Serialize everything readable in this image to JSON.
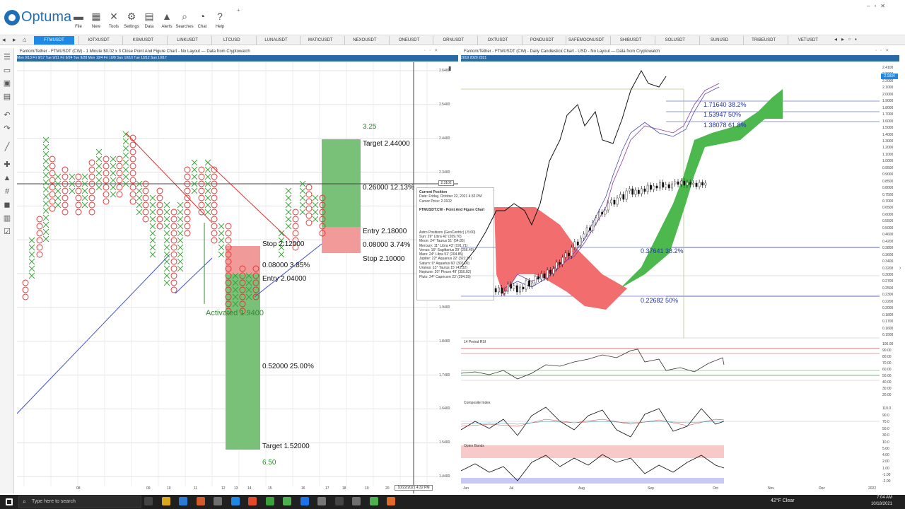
{
  "app": {
    "logo_text": "Optuma"
  },
  "ribbon": {
    "buttons": [
      {
        "label": "File",
        "icon": "folder-icon",
        "glyph": "▬"
      },
      {
        "label": "New",
        "icon": "new-chart-icon",
        "glyph": "▦"
      },
      {
        "label": "Tools",
        "icon": "tools-icon",
        "glyph": "✕"
      },
      {
        "label": "Settings",
        "icon": "gear-icon",
        "glyph": "⚙"
      },
      {
        "label": "Data",
        "icon": "data-icon",
        "glyph": "▤"
      },
      {
        "label": "Alerts",
        "icon": "alert-icon",
        "glyph": "▲"
      },
      {
        "label": "Searches",
        "icon": "search-icon",
        "glyph": "⌕"
      },
      {
        "label": "Chat",
        "icon": "chat-icon",
        "glyph": "◔"
      },
      {
        "label": "Help",
        "icon": "help-icon",
        "glyph": "?"
      }
    ]
  },
  "symbols": [
    "FTMUSDT",
    "IOTXUSDT",
    "KSMUSDT",
    "LINKUSDT",
    "LTCUSD",
    "LUNAUSDT",
    "MATICUSDT",
    "NEXOUSDT",
    "ONEUSDT",
    "ORNUSDT",
    "OXTUSDT",
    "PONDUSDT",
    "SAFEMOONUSDT",
    "SHIBUSDT",
    "SOLUSDT",
    "SUNUSD",
    "TRIBEUSDT",
    "VETUSDT"
  ],
  "left_chart": {
    "title": "Fantom/Tether - FTMUSDT (CW) - 1 Minute $0.02 x 3 Close Point And Figure Chart - No Layout — Data from Cryptowatch",
    "date_bar": "Mon 9/13   Fri 9/17   Tue 9/21   Fri 9/24   Tue 9/28   Mon 10/4        Fri 10/8            Sun 10/10     Tue 10/12   Sun 10/17",
    "y_labels": [
      "2.6400",
      "2.5400",
      "2.4400",
      "2.3400",
      "2.2400",
      "2.1400",
      "2.0400",
      "1.9400",
      "1.8400",
      "1.7400",
      "1.6400",
      "1.5400",
      "1.4400"
    ],
    "price_tag": "2.3102",
    "x_labels": [
      "08",
      "09",
      "10",
      "11",
      "12",
      "13",
      "14",
      "15",
      "16",
      "17",
      "18",
      "19",
      "20",
      "21"
    ],
    "x_cursor_label": "10/22/2021 4:32 PM",
    "upper_trade": {
      "score": "3.25",
      "target": "Target  2.44000",
      "risk": "0.26000   12.13%",
      "entry": "Entry  2.18000",
      "reward": "0.08000   3.74%",
      "stop": "Stop  2.10000"
    },
    "lower_trade": {
      "stop": "Stop  2.12000",
      "risk": "0.08000   3.85%",
      "entry": "Entry  2.04000",
      "activated": "Activated 1.9400",
      "reward": "0.52000   25.00%",
      "target": "Target  1.52000",
      "score": "6.50"
    }
  },
  "popup": {
    "heading": "Current Position",
    "lines": [
      "Date: Friday, October 22, 2021 4:32 PM",
      "Cursor Price: 2.3102",
      "",
      "FTMUSDT:CW - Point And Figure Chart",
      "",
      "",
      "",
      "",
      "Astro Positions (GeoCentric) (-5:00)",
      "Sun: 29° Libra 42' (209.70)",
      "Moon: 24° Taurus 51' (54.85)",
      "Mercury: 11° Libra 43' (191.71)",
      "Venus: 16° Sagittarius 29' (256.49)",
      "Mars: 24° Libra 51' (204.85)",
      "Jupiter: 22° Aquarius 22' (322.37)",
      "Saturn: 6° Aquarius 60' (307.00)",
      "Uranus: 13° Taurus 15' (43.32)",
      "Neptune: 20° Pisces 49' (350.82)",
      "Pluto: 24° Capricorn 23' (294.39)"
    ]
  },
  "right_chart": {
    "title": "Fantom/Tether - FTMUSDT (CW) - Daily Candlestick Chart - USD - No Layout — Data from Cryptowatch",
    "year_bar": "2019                                   2020                                          2021",
    "y_labels": [
      "2.4100",
      "2.3000",
      "2.2000",
      "2.1000",
      "2.0000",
      "1.9000",
      "1.8000",
      "1.7000",
      "1.6000",
      "1.5000",
      "1.4000",
      "1.3000",
      "1.2000",
      "1.1000",
      "1.0000",
      "0.9500",
      "0.9000",
      "0.8500",
      "0.8000",
      "0.7500",
      "0.7000",
      "0.6500",
      "0.6000",
      "0.5500",
      "0.5000",
      "0.4600",
      "0.4200",
      "0.3800",
      "0.3600",
      "0.3400",
      "0.3200",
      "0.3000",
      "0.2700",
      "0.2500",
      "0.2300",
      "0.2200",
      "0.2000",
      "0.1800",
      "0.1700",
      "0.1600",
      "0.1500"
    ],
    "price_tag": "2.1834",
    "fibs_upper": [
      {
        "label": "1.71640   38.2%"
      },
      {
        "label": "1.53947   50%"
      },
      {
        "label": "1.38078   61.8%"
      }
    ],
    "fibs_lower": [
      {
        "label": "0.37641   38.2%"
      },
      {
        "label": "0.22682   50%"
      }
    ],
    "rsi": {
      "title": "14 Period RSI",
      "labels": [
        "100.00",
        "90.00",
        "80.00",
        "70.00",
        "60.00",
        "50.00",
        "40.00",
        "30.00",
        "20.00"
      ]
    },
    "composite": {
      "title": "Composite Index",
      "labels": [
        "110.0",
        "90.0",
        "70.0",
        "50.0",
        "30.0",
        "10.0"
      ]
    },
    "optex": {
      "title": "Optex Bands",
      "labels": [
        "5.00",
        "4.00",
        "2.00",
        "1.00",
        "-1.00",
        "-2.00"
      ]
    },
    "x_labels": [
      "Jun",
      "Jul",
      "Aug",
      "Sep",
      "Oct",
      "Nov",
      "Dec",
      "2022"
    ]
  },
  "taskbar": {
    "search_placeholder": "Type here to search",
    "weather": "42°F  Clear",
    "time": "7:04 AM",
    "date": "10/18/2021"
  }
}
